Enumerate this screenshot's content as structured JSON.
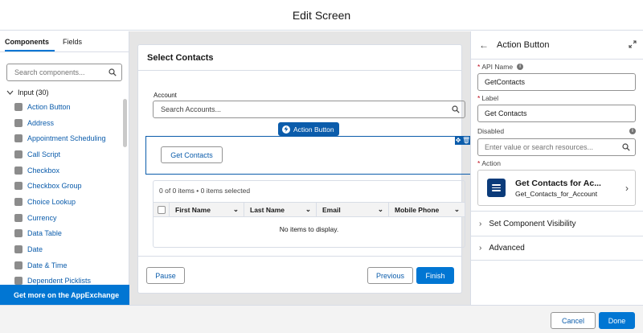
{
  "header": {
    "title": "Edit Screen"
  },
  "left_panel": {
    "tabs": [
      {
        "label": "Components",
        "active": true
      },
      {
        "label": "Fields",
        "active": false
      }
    ],
    "search": {
      "placeholder": "Search components..."
    },
    "group": {
      "label": "Input (30)"
    },
    "items": [
      {
        "label": "Action Button",
        "icon": "bolt-icon"
      },
      {
        "label": "Address",
        "icon": "location-icon"
      },
      {
        "label": "Appointment Scheduling",
        "icon": "calendar-icon"
      },
      {
        "label": "Call Script",
        "icon": "phone-icon"
      },
      {
        "label": "Checkbox",
        "icon": "checkbox-icon"
      },
      {
        "label": "Checkbox Group",
        "icon": "checkbox-group-icon"
      },
      {
        "label": "Choice Lookup",
        "icon": "lookup-icon"
      },
      {
        "label": "Currency",
        "icon": "currency-icon"
      },
      {
        "label": "Data Table",
        "icon": "table-icon"
      },
      {
        "label": "Date",
        "icon": "date-icon"
      },
      {
        "label": "Date & Time",
        "icon": "datetime-icon"
      },
      {
        "label": "Dependent Picklists",
        "icon": "picklist-icon"
      }
    ],
    "appexchange_label": "Get more on the AppExchange"
  },
  "canvas": {
    "card_title": "Select Contacts",
    "account": {
      "label": "Account",
      "placeholder": "Search Accounts..."
    },
    "selected_badge": "Action Button",
    "get_contacts_label": "Get Contacts",
    "table": {
      "count_text": "0 of 0 items • 0 items selected",
      "columns": [
        "First Name",
        "Last Name",
        "Email",
        "Mobile Phone"
      ],
      "empty_text": "No items to display."
    },
    "footer": {
      "pause": "Pause",
      "previous": "Previous",
      "finish": "Finish"
    }
  },
  "right_panel": {
    "title": "Action Button",
    "api_name": {
      "label": "API Name",
      "value": "GetContacts"
    },
    "label_field": {
      "label": "Label",
      "value": "Get Contacts"
    },
    "disabled": {
      "label": "Disabled",
      "placeholder": "Enter value or search resources..."
    },
    "action": {
      "label": "Action",
      "name": "Get Contacts for Ac...",
      "api": "Get_Contacts_for_Account"
    },
    "sections": [
      "Set Component Visibility",
      "Advanced"
    ]
  },
  "footer": {
    "cancel": "Cancel",
    "done": "Done"
  },
  "colors": {
    "brand": "#0176d3",
    "link": "#0b5cab",
    "required": "#ba0517"
  }
}
